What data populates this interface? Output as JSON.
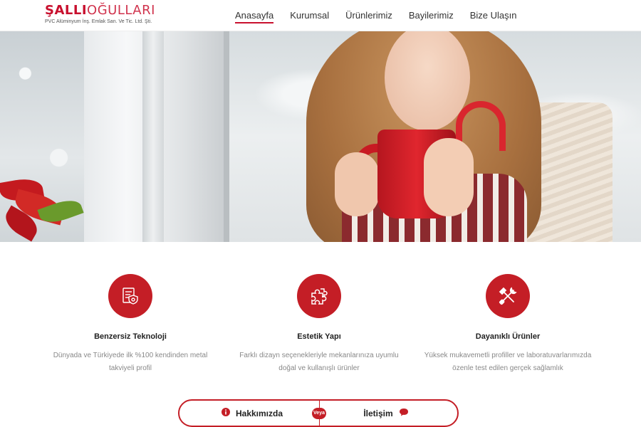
{
  "brand": {
    "name_bold": "ŞALLI",
    "name_light": "OĞULLARI",
    "subtitle": "PVC Alüminyum İnş. Emlak San. Ve Tic. Ltd. Şti.",
    "accent_color": "#c41e26"
  },
  "nav": {
    "items": [
      {
        "label": "Anasayfa",
        "active": true
      },
      {
        "label": "Kurumsal",
        "active": false
      },
      {
        "label": "Ürünlerimiz",
        "active": false
      },
      {
        "label": "Bayilerimiz",
        "active": false
      },
      {
        "label": "Bize Ulaşın",
        "active": false
      }
    ]
  },
  "hero": {
    "slide_indicator_count": 1
  },
  "features": [
    {
      "icon": "technology-document-icon",
      "title": "Benzersiz Teknoloji",
      "line1": "Dünyada ve Türkiyede ilk %100 kendinden metal",
      "line2": "takviyeli profil"
    },
    {
      "icon": "puzzle-icon",
      "title": "Estetik Yapı",
      "line1": "Farklı dizayn seçenekleriyle mekanlarınıza uyumlu",
      "line2": "doğal ve kullanışlı ürünler"
    },
    {
      "icon": "tools-icon",
      "title": "Dayanıklı Ürünler",
      "line1": "Yüksek mukavemetli profiller ve laboratuvarlarımızda",
      "line2": "özenle test edilen gerçek sağlamlık"
    }
  ],
  "cta": {
    "left_label": "Hakkımızda",
    "left_icon": "info-icon",
    "separator_label": "Veya",
    "right_label": "İletişim",
    "right_icon": "chat-bubble-icon"
  }
}
